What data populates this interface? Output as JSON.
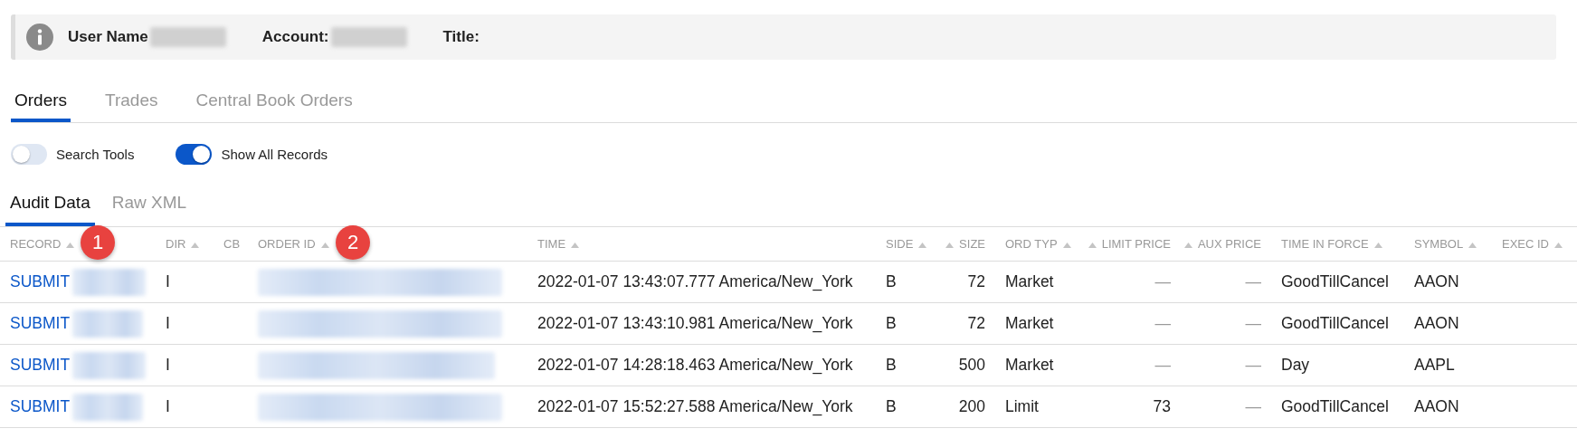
{
  "info_bar": {
    "fields": [
      {
        "label": "User Name"
      },
      {
        "label": "Account:"
      },
      {
        "label": "Title:"
      }
    ]
  },
  "tabs": [
    {
      "label": "Orders",
      "selected": true
    },
    {
      "label": "Trades",
      "selected": false
    },
    {
      "label": "Central Book Orders",
      "selected": false
    }
  ],
  "toggles": [
    {
      "label": "Search Tools",
      "on": false
    },
    {
      "label": "Show All Records",
      "on": true
    }
  ],
  "subtabs": [
    {
      "label": "Audit Data",
      "selected": true
    },
    {
      "label": "Raw XML",
      "selected": false
    }
  ],
  "table": {
    "columns": [
      {
        "label": "RECORD",
        "sortable": true
      },
      {
        "label": "DIR",
        "sortable": true
      },
      {
        "label": "CB",
        "sortable": false
      },
      {
        "label": "ORDER ID",
        "sortable": true
      },
      {
        "label": "TIME",
        "sortable": true
      },
      {
        "label": "SIDE",
        "sortable": true
      },
      {
        "label": "SIZE",
        "sortable": true
      },
      {
        "label": "ORD TYP",
        "sortable": true
      },
      {
        "label": "LIMIT PRICE",
        "sortable": true
      },
      {
        "label": "AUX PRICE",
        "sortable": true
      },
      {
        "label": "TIME IN FORCE",
        "sortable": true
      },
      {
        "label": "SYMBOL",
        "sortable": true
      },
      {
        "label": "EXEC ID",
        "sortable": true
      }
    ],
    "rows": [
      {
        "record": "SUBMIT",
        "dir": "I",
        "time": "2022-01-07 13:43:07.777 America/New_York",
        "side": "B",
        "size": "72",
        "ord_typ": "Market",
        "limit_price": "—",
        "aux_price": "—",
        "time_in_force": "GoodTillCancel",
        "symbol": "AAON"
      },
      {
        "record": "SUBMIT",
        "dir": "I",
        "time": "2022-01-07 13:43:10.981 America/New_York",
        "side": "B",
        "size": "72",
        "ord_typ": "Market",
        "limit_price": "—",
        "aux_price": "—",
        "time_in_force": "GoodTillCancel",
        "symbol": "AAON"
      },
      {
        "record": "SUBMIT",
        "dir": "I",
        "time": "2022-01-07 14:28:18.463 America/New_York",
        "side": "B",
        "size": "500",
        "ord_typ": "Market",
        "limit_price": "—",
        "aux_price": "—",
        "time_in_force": "Day",
        "symbol": "AAPL"
      },
      {
        "record": "SUBMIT",
        "dir": "I",
        "time": "2022-01-07 15:52:27.588 America/New_York",
        "side": "B",
        "size": "200",
        "ord_typ": "Limit",
        "limit_price": "73",
        "aux_price": "—",
        "time_in_force": "GoodTillCancel",
        "symbol": "AAON"
      }
    ]
  },
  "callouts": [
    {
      "label": "1"
    },
    {
      "label": "2"
    }
  ]
}
